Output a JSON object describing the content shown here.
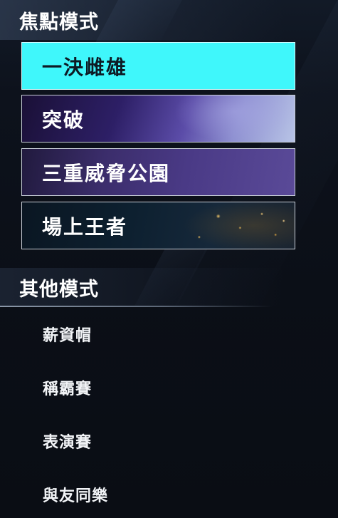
{
  "featured": {
    "header": "焦點模式",
    "modes": [
      {
        "label": "一決雌雄",
        "selected": true
      },
      {
        "label": "突破",
        "selected": false
      },
      {
        "label": "三重威脅公園",
        "selected": false
      },
      {
        "label": "場上王者",
        "selected": false
      }
    ]
  },
  "other": {
    "header": "其他模式",
    "items": [
      {
        "label": "薪資帽"
      },
      {
        "label": "稱霸賽"
      },
      {
        "label": "表演賽"
      },
      {
        "label": "與友同樂"
      }
    ]
  },
  "colors": {
    "selected_bg": "#3ff7fb",
    "background": "#0c1018"
  }
}
